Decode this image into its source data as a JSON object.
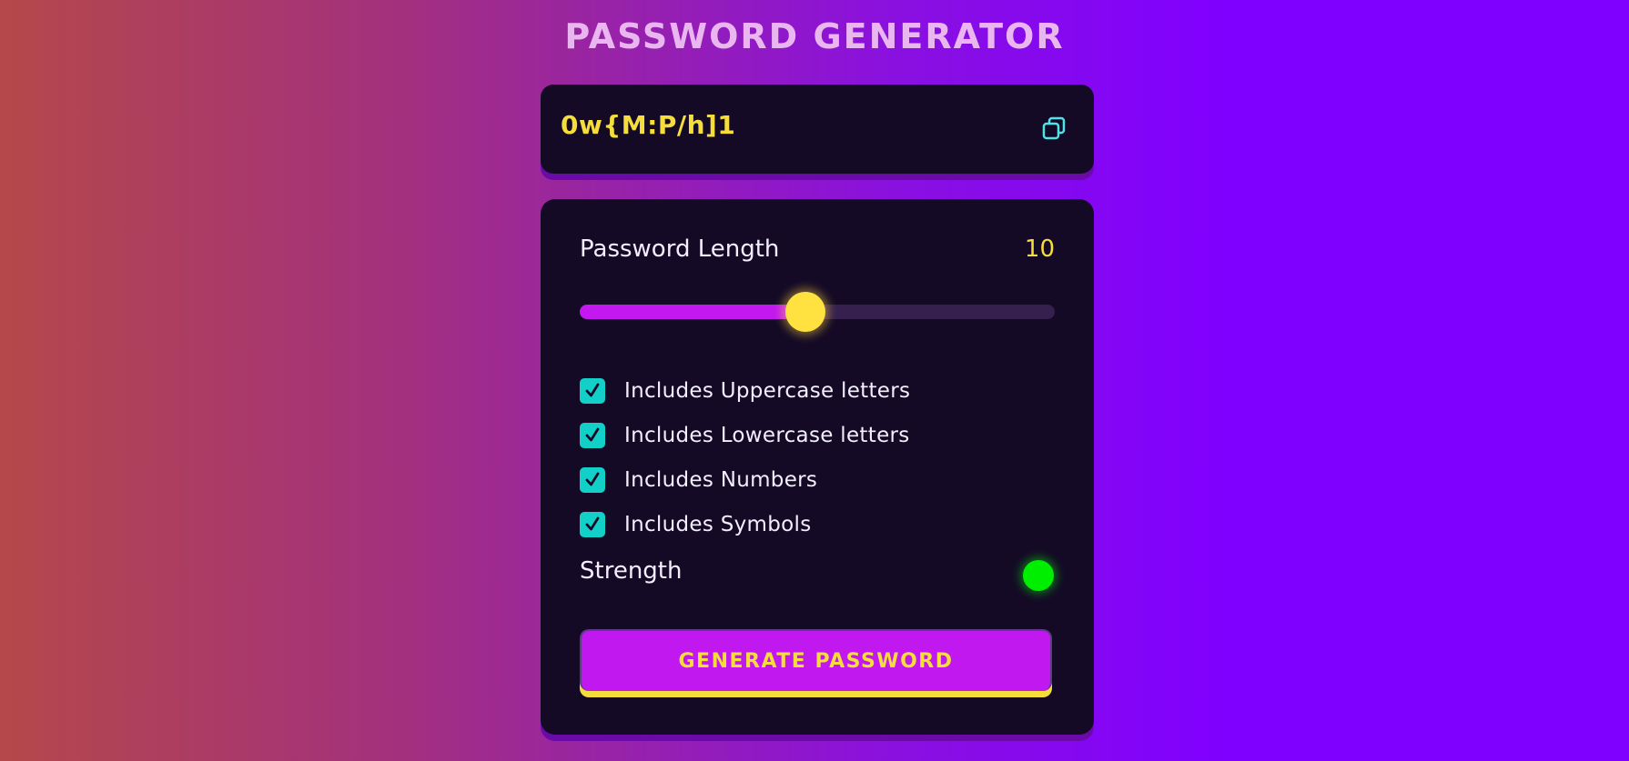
{
  "app": {
    "title": "PASSWORD GENERATOR"
  },
  "output": {
    "password": "0w{M:P/h]1",
    "copy_icon": "copy-icon"
  },
  "length": {
    "label": "Password Length",
    "value": "10",
    "slider_fraction": 0.475
  },
  "options": [
    {
      "label": "Includes Uppercase letters",
      "checked": true
    },
    {
      "label": "Includes Lowercase letters",
      "checked": true
    },
    {
      "label": "Includes Numbers",
      "checked": true
    },
    {
      "label": "Includes Symbols",
      "checked": true
    }
  ],
  "strength": {
    "label": "Strength",
    "indicator_color": "#00ee00"
  },
  "generate_button": {
    "label": "GENERATE PASSWORD"
  },
  "colors": {
    "accent": "#c318ef",
    "highlight": "#f5dd3c",
    "checkbox": "#12cfc7",
    "panel": "#140a26"
  }
}
